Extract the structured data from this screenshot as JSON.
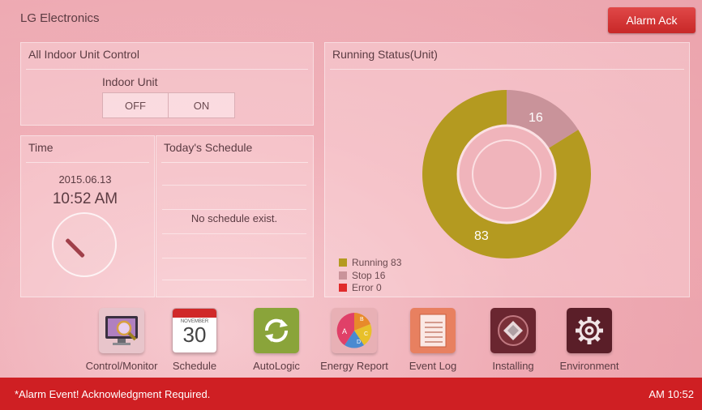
{
  "header": {
    "title": "LG Electronics",
    "alarm_button": "Alarm Ack"
  },
  "indoor_control": {
    "title": "All Indoor Unit Control",
    "label": "Indoor Unit",
    "off": "OFF",
    "on": "ON"
  },
  "time": {
    "title": "Time",
    "date": "2015.06.13",
    "time": "10:52 AM"
  },
  "schedule": {
    "title": "Today's Schedule",
    "empty_message": "No schedule exist."
  },
  "running_status": {
    "title": "Running Status(Unit)",
    "running_value": "83",
    "stop_value": "16",
    "legend": {
      "running": "Running 83",
      "stop": "Stop 16",
      "error": "Error 0"
    },
    "colors": {
      "running": "#b49a20",
      "stop": "#c9939a",
      "error": "#e02a2a"
    }
  },
  "chart_data": {
    "type": "pie",
    "title": "Running Status(Unit)",
    "categories": [
      "Running",
      "Stop",
      "Error"
    ],
    "values": [
      83,
      16,
      0
    ]
  },
  "nav": [
    {
      "label": "Control/Monitor",
      "icon": "monitor-magnifier-icon"
    },
    {
      "label": "Schedule",
      "icon": "calendar-icon",
      "month": "NOVEMBER",
      "day": "30"
    },
    {
      "label": "AutoLogic",
      "icon": "refresh-cycle-icon"
    },
    {
      "label": "Energy Report",
      "icon": "pie-chart-icon",
      "letters": [
        "A",
        "B",
        "C",
        "D"
      ]
    },
    {
      "label": "Event Log",
      "icon": "document-list-icon"
    },
    {
      "label": "Installing",
      "icon": "ceiling-cassette-icon"
    },
    {
      "label": "Environment",
      "icon": "gear-icon"
    }
  ],
  "status_bar": {
    "message": "*Alarm Event! Acknowledgment Required.",
    "time": "AM 10:52"
  }
}
